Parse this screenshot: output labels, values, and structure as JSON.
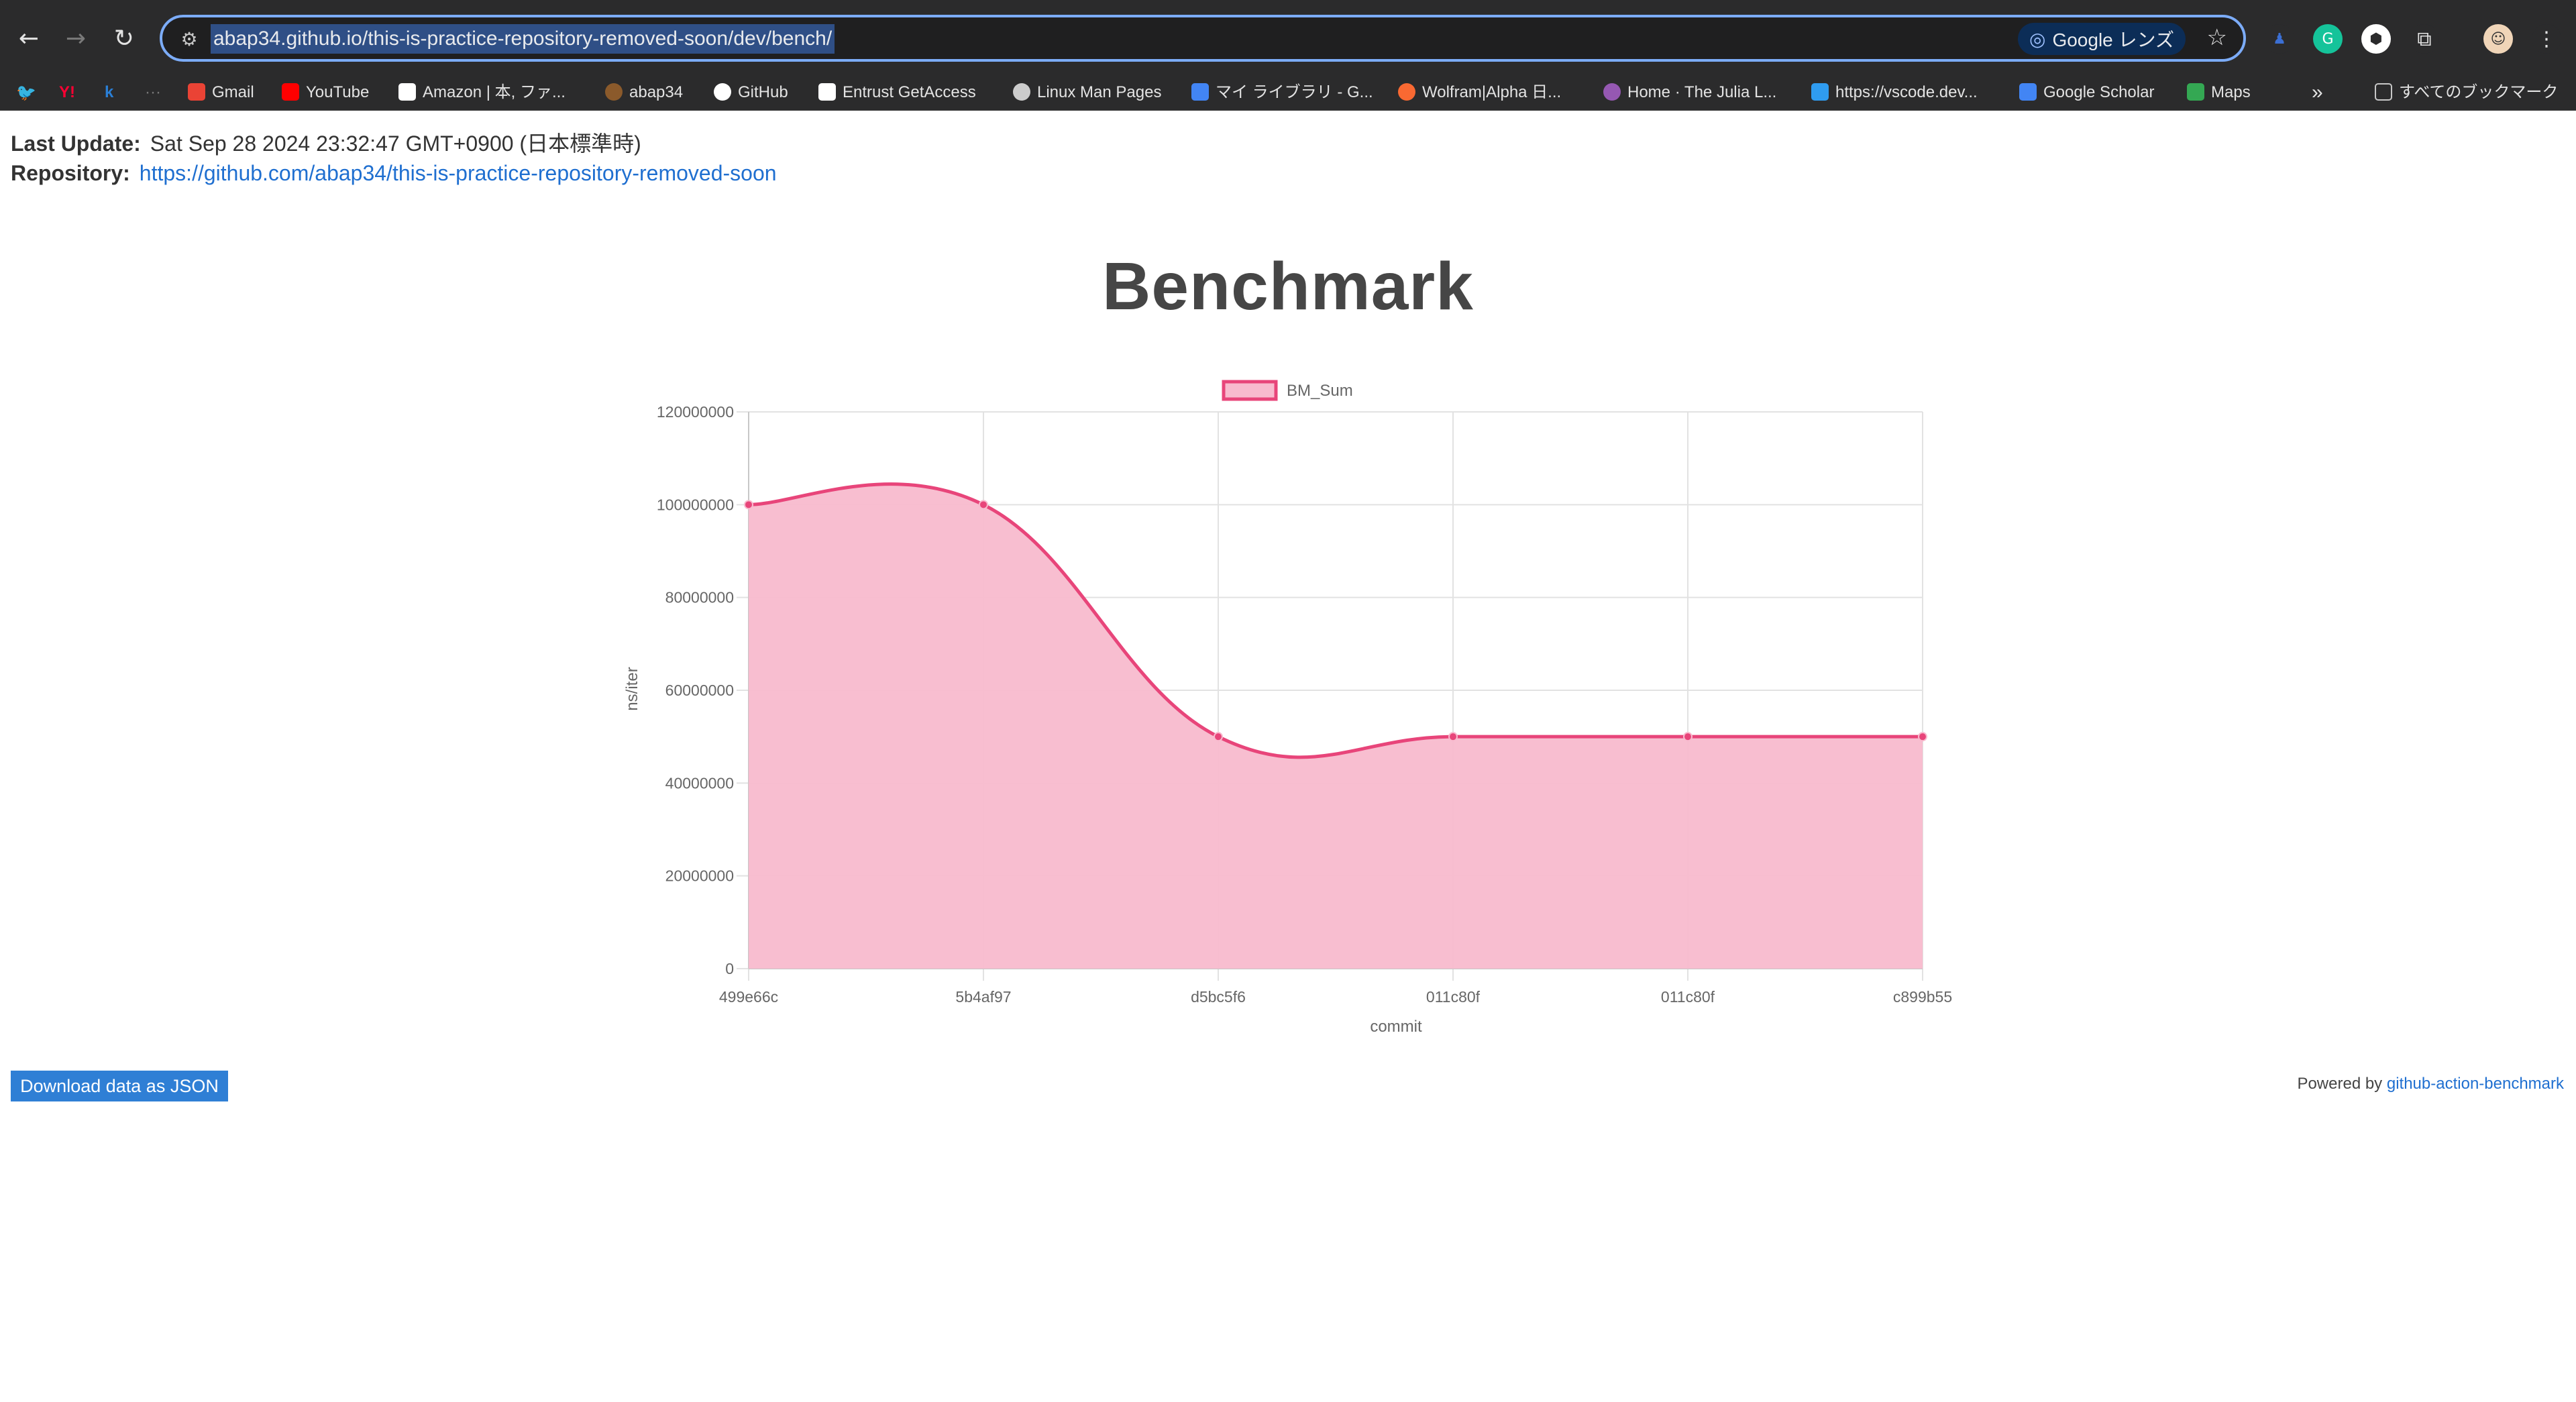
{
  "browser": {
    "url": "abap34.github.io/this-is-practice-repository-removed-soon/dev/bench/",
    "lens_label": "Google レンズ",
    "bookmarks": [
      {
        "label": "Gmail",
        "icon": "gmail-icon",
        "color": "#ea4335"
      },
      {
        "label": "YouTube",
        "icon": "youtube-icon",
        "color": "#ff0000"
      },
      {
        "label": "Amazon | 本, ファ...",
        "icon": "amazon-icon",
        "color": "#ffffff"
      },
      {
        "label": "abap34",
        "icon": "abap34-icon",
        "color": "#8b5a2b"
      },
      {
        "label": "GitHub",
        "icon": "github-icon",
        "color": "#ffffff"
      },
      {
        "label": "Entrust GetAccess",
        "icon": "entrust-icon",
        "color": "#ffffff"
      },
      {
        "label": "Linux Man Pages",
        "icon": "globe-icon",
        "color": "#cccccc"
      },
      {
        "label": "マイ ライブラリ - G...",
        "icon": "scholar-icon",
        "color": "#4285f4"
      },
      {
        "label": "Wolfram|Alpha 日...",
        "icon": "wolfram-icon",
        "color": "#f96932"
      },
      {
        "label": "Home · The Julia L...",
        "icon": "julia-icon",
        "color": "#9558b2"
      },
      {
        "label": "https://vscode.dev...",
        "icon": "vscode-icon",
        "color": "#2f9cf0"
      },
      {
        "label": "Google Scholar",
        "icon": "scholar-icon",
        "color": "#4285f4"
      },
      {
        "label": "Maps",
        "icon": "maps-icon",
        "color": "#34a853"
      }
    ],
    "more_label": "»",
    "all_bookmarks_label": "すべてのブックマーク"
  },
  "page": {
    "last_update_label": "Last Update:",
    "last_update_value": "Sat Sep 28 2024 23:32:47 GMT+0900 (日本標準時)",
    "repository_label": "Repository:",
    "repository_url": "https://github.com/abap34/this-is-practice-repository-removed-soon",
    "download_label": "Download data as JSON",
    "powered_prefix": "Powered by",
    "powered_link": "github-action-benchmark"
  },
  "chart_data": {
    "type": "area",
    "title": "Benchmark",
    "xlabel": "commit",
    "ylabel": "ns/iter",
    "categories": [
      "499e66c",
      "5b4af97",
      "d5bc5f6",
      "011c80f",
      "011c80f",
      "c899b55"
    ],
    "series": [
      {
        "name": "BM_Sum",
        "values": [
          100000000,
          100000000,
          50000000,
          50000000,
          50000000,
          50000000
        ]
      }
    ],
    "ylim": [
      0,
      120000000
    ],
    "yticks": [
      "0",
      "20000000",
      "40000000",
      "60000000",
      "80000000",
      "100000000",
      "120000000"
    ],
    "grid": true,
    "legend": "top",
    "colors": {
      "line": "#e8457a",
      "fill": "#f8bace"
    }
  }
}
